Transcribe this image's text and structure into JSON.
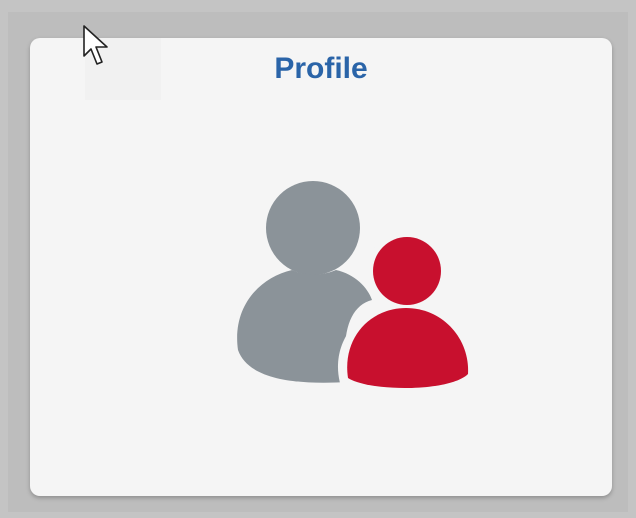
{
  "tile": {
    "title": "Profile",
    "icon": "people-icon",
    "colors": {
      "title": "#2a64a8",
      "person_back": "#8b9399",
      "person_front": "#c8102e",
      "tile_background": "#f5f5f5"
    }
  },
  "cursor": {
    "icon": "mouse-pointer-icon"
  }
}
